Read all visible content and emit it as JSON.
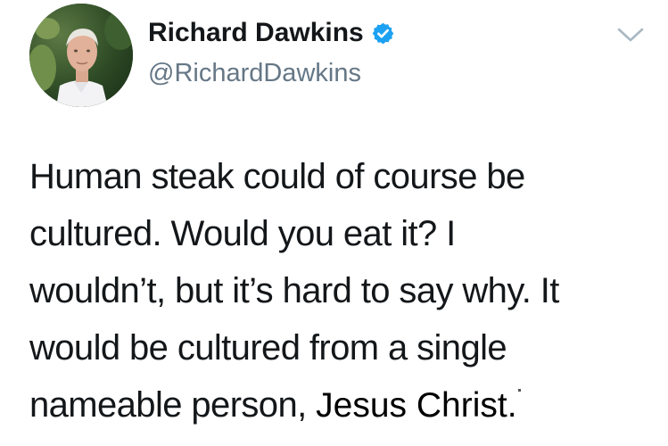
{
  "author": {
    "display_name": "Richard Dawkins",
    "handle": "@RichardDawkins",
    "verified": true
  },
  "icons": {
    "verified": "verified-badge-icon",
    "more": "chevron-down-icon",
    "avatar": "profile-photo"
  },
  "colors": {
    "text": "#14171a",
    "secondary": "#657786",
    "verified_blue": "#1da1f2"
  },
  "tweet": {
    "lines": [
      "Human steak could of course be",
      "cultured. Would you eat it? I",
      "wouldn’t, but it’s hard to say why. It",
      "would be cultured from a single",
      "nameable person, "
    ],
    "overlay_text": "Jesus Christ."
  }
}
